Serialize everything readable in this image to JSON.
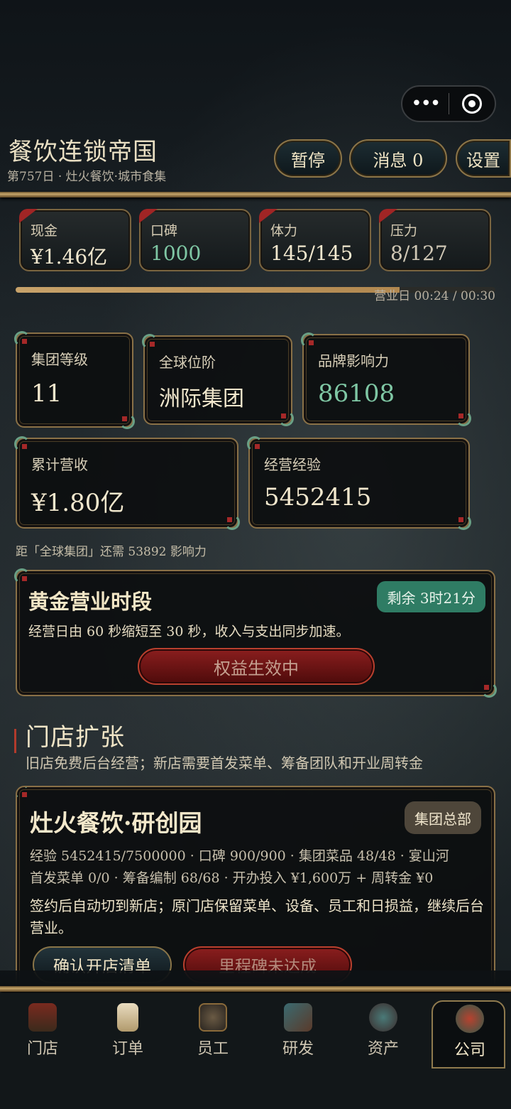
{
  "capsule": {
    "more_icon": "more-dots-icon",
    "close_icon": "target-icon"
  },
  "header": {
    "title": "餐饮连锁帝国",
    "subtitle": "第757日 · 灶火餐饮·城市食集",
    "pause_label": "暂停",
    "messages_label": "消息 0",
    "settings_label": "设置"
  },
  "stats": [
    {
      "label": "现金",
      "value": "¥1.46亿"
    },
    {
      "label": "口碑",
      "value": "1000"
    },
    {
      "label": "体力",
      "value": "145/145"
    },
    {
      "label": "压力",
      "value": "8/127"
    }
  ],
  "day_progress": {
    "text": "营业日 00:24 / 00:30",
    "fraction": 0.8
  },
  "company": {
    "level_label": "集团等级",
    "level_value": "11",
    "rank_label": "全球位阶",
    "rank_value": "洲际集团",
    "influence_label": "品牌影响力",
    "influence_value": "86108",
    "revenue_label": "累计营收",
    "revenue_value": "¥1.80亿",
    "exp_label": "经营经验",
    "exp_value": "5452415",
    "next_rank_note": "距「全球集团」还需 53892 影响力"
  },
  "golden_hour": {
    "title": "黄金营业时段",
    "remaining": "剩余 3时21分",
    "description": "经营日由 60 秒缩短至 30 秒，收入与支出同步加速。",
    "button": "权益生效中"
  },
  "expansion": {
    "title": "门店扩张",
    "description": "旧店免费后台经营；新店需要首发菜单、筹备团队和开业周转金"
  },
  "store": {
    "name": "灶火餐饮·研创园",
    "badge": "集团总部",
    "line1": "经验 5452415/7500000 · 口碑 900/900 · 集团菜品 48/48 · 宴山河",
    "line2": "首发菜单 0/0 · 筹备编制 68/68 · 开办投入 ¥1,600万 + 周转金 ¥0",
    "note": "签约后自动切到新店；原门店保留菜单、设备、员工和日损益，继续后台营业。",
    "confirm_button": "确认开店清单",
    "milestone_button": "里程碑未达成"
  },
  "tabs": [
    {
      "label": "门店",
      "icon": "store-icon"
    },
    {
      "label": "订单",
      "icon": "order-scroll-icon"
    },
    {
      "label": "员工",
      "icon": "staff-portrait-icon"
    },
    {
      "label": "研发",
      "icon": "research-book-icon"
    },
    {
      "label": "资产",
      "icon": "assets-icon"
    },
    {
      "label": "公司",
      "icon": "company-icon"
    }
  ],
  "colors": {
    "accent_gold": "#c7a66a",
    "accent_green": "#7fc7a4",
    "accent_red": "#8a1e1e"
  }
}
